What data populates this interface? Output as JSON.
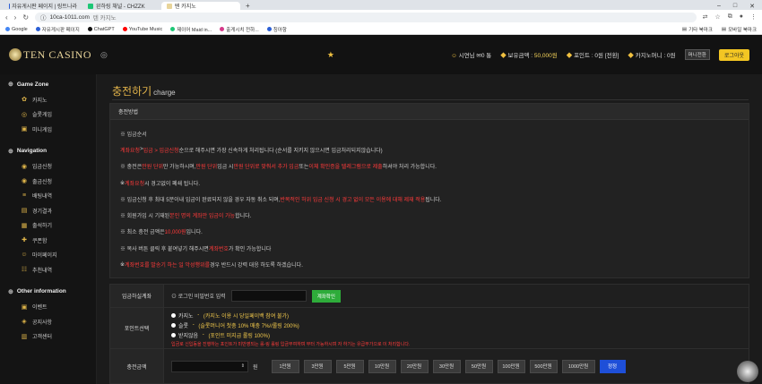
{
  "browser": {
    "tabs": [
      {
        "label": "자유게시판 페이지 | 링트나라",
        "fav_color": "#2b5fd6",
        "active": false
      },
      {
        "label": "왼하링 채널 - CHZZK",
        "fav_color": "#1dc776",
        "active": false
      },
      {
        "label": "텐 카지노",
        "fav_color": "#e8d49a",
        "active": true
      }
    ],
    "new_tab": "+",
    "window_controls": [
      "–",
      "□",
      "✕"
    ],
    "url_host": "10ca-1011.com",
    "url_title": "텐 카지노",
    "bookmarks": [
      {
        "label": "Google",
        "color": "#4285f4"
      },
      {
        "label": "자유게시판 페이지",
        "color": "#2b5fd6"
      },
      {
        "label": "ChatGPT",
        "color": "#111111"
      },
      {
        "label": "YouTube Music",
        "color": "#ff0000"
      },
      {
        "label": "제이어 Maid in...",
        "color": "#1dc776"
      },
      {
        "label": "출게시치 전하...",
        "color": "#d63a8a"
      },
      {
        "label": "칭아항",
        "color": "#2b5fd6"
      }
    ],
    "bookmarks_right": [
      "기타 북마크",
      "모바일 북마크"
    ]
  },
  "header": {
    "logo_text": "TEN CASINO",
    "user": "시연님",
    "user_count": "0 통",
    "balance_label": "보유금액 :",
    "balance": "50,000원",
    "point_label": "포인트 : 0원",
    "point_convert": "[전환]",
    "casino_money": "카지노머니 : 0원",
    "mini_btn": "머니전환",
    "logout": "로그아웃"
  },
  "sidebar": {
    "sections": [
      {
        "title": "Game Zone",
        "items": [
          "카지노",
          "슬롯게임",
          "미니게임"
        ]
      },
      {
        "title": "Navigation",
        "items": [
          "입금신청",
          "출금신청",
          "배팅내역",
          "경기결과",
          "출석하기",
          "쿠폰함",
          "마이페이지",
          "추천내역"
        ]
      },
      {
        "title": "Other information",
        "items": [
          "이벤트",
          "공지사항",
          "고객센터"
        ]
      }
    ]
  },
  "main": {
    "title": "충전하기",
    "title_sub": "charge",
    "notice_title": "충전방법",
    "notice_lines": [
      [
        {
          "t": "※ 입금순서",
          "r": false
        }
      ],
      [
        {
          "t": "계좌요청",
          "r": true
        },
        {
          "t": " > ",
          "r": false
        },
        {
          "t": "입금 > 입금신청",
          "r": true
        },
        {
          "t": " 순으로 해주시면 가장 신속하게 처리됩니다 (순서를 지키지 않으시면 입금처리되지않습니다)",
          "r": false
        }
      ],
      [
        {
          "t": "※ 충전은 ",
          "r": false
        },
        {
          "t": "만원 단위",
          "r": true
        },
        {
          "t": " 만 가능하시며, ",
          "r": false
        },
        {
          "t": "만원 단위",
          "r": true
        },
        {
          "t": " 입금 시 ",
          "r": false
        },
        {
          "t": "만원 단위로 맞춰서 추가 입금",
          "r": true
        },
        {
          "t": " 또는 ",
          "r": false
        },
        {
          "t": "이체 확인증을 텔레그램으로 제출",
          "r": true
        },
        {
          "t": " 하셔야 처리 가능합니다.",
          "r": false
        }
      ],
      [
        {
          "t": "※ ",
          "r": false
        },
        {
          "t": "계좌요청",
          "r": true
        },
        {
          "t": " 시 경고없이 폐쇄 됩니다.",
          "r": false
        }
      ],
      [
        {
          "t": "※ 입금신청 후 최대 5분이내 입금이 완료되지 않을 경우 자동 취소 되며, ",
          "r": false
        },
        {
          "t": "반복적인 허위 입금 신청 시 경고 없이 모든 이용에 대해 제재 적용",
          "r": true
        },
        {
          "t": "됩니다.",
          "r": false
        }
      ],
      [
        {
          "t": "※ 회원가입 시 기재된 ",
          "r": false
        },
        {
          "t": "본인 명의 계좌만 입금이 가능",
          "r": true
        },
        {
          "t": " 합니다.",
          "r": false
        }
      ],
      [
        {
          "t": "※ 최소 충전 금액은 ",
          "r": false
        },
        {
          "t": "10,000원",
          "r": true
        },
        {
          "t": " 입니다.",
          "r": false
        }
      ],
      [
        {
          "t": "※ 복사 버튼 클릭 후 붙여넣기 해주시면 ",
          "r": false
        },
        {
          "t": "계좌번호",
          "r": true
        },
        {
          "t": " 가 확인 가능합니다",
          "r": false
        }
      ],
      [
        {
          "t": "※ ",
          "r": false
        },
        {
          "t": "계좌번호를 발송기 하는 일 악성행위를",
          "r": true
        },
        {
          "t": " 경우 반드시 강력 대응 하도록 하겠습니다.",
          "r": false
        }
      ]
    ],
    "form": {
      "account_label": "입금하실계좌",
      "login_pw_label": "⊙ 로그인 비밀번호 입력",
      "account_check_btn": "계좌확인",
      "point_label": "포인트선택",
      "point_options": [
        {
          "name": "카지노",
          "desc": "(카지노 이용 시 당일페이백 참여 불가)"
        },
        {
          "name": "슬롯",
          "desc": "(슬롯머니어 첫충 10% 매충 7%//롤링 200%)"
        },
        {
          "name": "받지않음",
          "desc": "(포인트 미지급 롤링 100%)"
        }
      ],
      "point_warning": "입금로 신입동을 진행하는 포인트가 미반영되는 롤-링 롤링 입금부여하며 부터 가능하시며 자 하기는 유급부가으로 이 처리합니다.",
      "amount_label": "충전금액",
      "won_unit": "원",
      "amount_buttons": [
        "1만원",
        "3만원",
        "5만원",
        "10만원",
        "20만원",
        "30만원",
        "50만원",
        "100만원",
        "500만원",
        "1000만원"
      ],
      "reset_btn": "정정"
    }
  }
}
